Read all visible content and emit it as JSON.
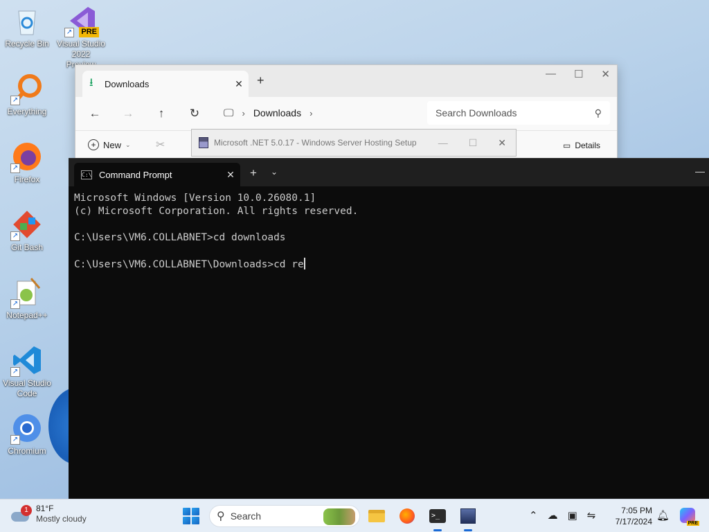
{
  "desktop": {
    "icons": [
      {
        "label": "Recycle Bin",
        "icon": "recycle-bin-icon"
      },
      {
        "label": "Visual Studio 2022 Preview",
        "icon": "visual-studio-preview-icon",
        "badge": "PRE"
      },
      {
        "label": "Everything",
        "icon": "everything-search-icon"
      },
      {
        "label": "Firefox",
        "icon": "firefox-icon"
      },
      {
        "label": "Git Bash",
        "icon": "git-bash-icon"
      },
      {
        "label": "Notepad++",
        "icon": "notepad-plus-plus-icon"
      },
      {
        "label": "Visual Studio Code",
        "icon": "vscode-icon"
      },
      {
        "label": "Chromium",
        "icon": "chromium-icon"
      }
    ]
  },
  "explorer": {
    "tab_label": "Downloads",
    "breadcrumb": "Downloads",
    "search_placeholder": "Search Downloads",
    "new_label": "New",
    "details_label": "Details"
  },
  "dotnet_window": {
    "title": "Microsoft .NET 5.0.17 - Windows Server Hosting Setup"
  },
  "terminal": {
    "tab_label": "Command Prompt",
    "lines": [
      "Microsoft Windows [Version 10.0.26080.1]",
      "(c) Microsoft Corporation. All rights reserved.",
      "",
      "C:\\Users\\VM6.COLLABNET>cd downloads",
      "",
      "C:\\Users\\VM6.COLLABNET\\Downloads>cd re"
    ]
  },
  "taskbar": {
    "weather_temp": "81°F",
    "weather_desc": "Mostly cloudy",
    "weather_badge": "1",
    "search_label": "Search",
    "time": "7:05 PM",
    "date": "7/17/2024",
    "copilot_badge": "PRE"
  },
  "colors": {
    "terminal_bg": "#0c0c0c",
    "terminal_text": "#cccccc",
    "accent": "#1a6ad6"
  }
}
